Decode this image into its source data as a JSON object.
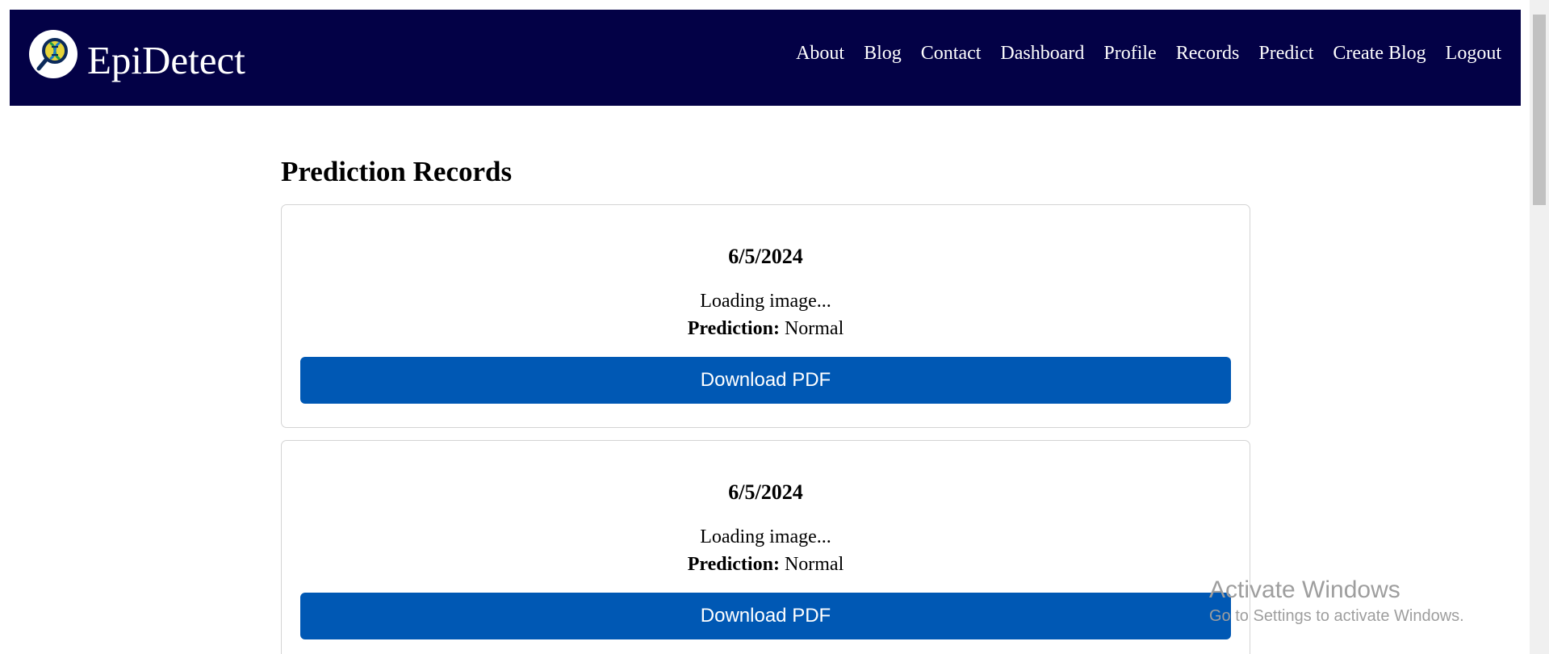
{
  "brand": {
    "name": "EpiDetect",
    "logo_icon": "dna-magnifier-icon"
  },
  "nav": [
    {
      "label": "About"
    },
    {
      "label": "Blog"
    },
    {
      "label": "Contact"
    },
    {
      "label": "Dashboard"
    },
    {
      "label": "Profile"
    },
    {
      "label": "Records"
    },
    {
      "label": "Predict"
    },
    {
      "label": "Create Blog"
    },
    {
      "label": "Logout"
    }
  ],
  "main": {
    "title": "Prediction Records",
    "records": [
      {
        "date": "6/5/2024",
        "image_status": "Loading image...",
        "prediction_label": "Prediction:",
        "prediction_value": "Normal",
        "download_label": "Download PDF"
      },
      {
        "date": "6/5/2024",
        "image_status": "Loading image...",
        "prediction_label": "Prediction:",
        "prediction_value": "Normal",
        "download_label": "Download PDF"
      }
    ]
  },
  "watermark": {
    "title": "Activate Windows",
    "subtitle": "Go to Settings to activate Windows."
  },
  "colors": {
    "navbar": "#030146",
    "button": "#0058b4",
    "card_border": "#d4d4d4"
  }
}
